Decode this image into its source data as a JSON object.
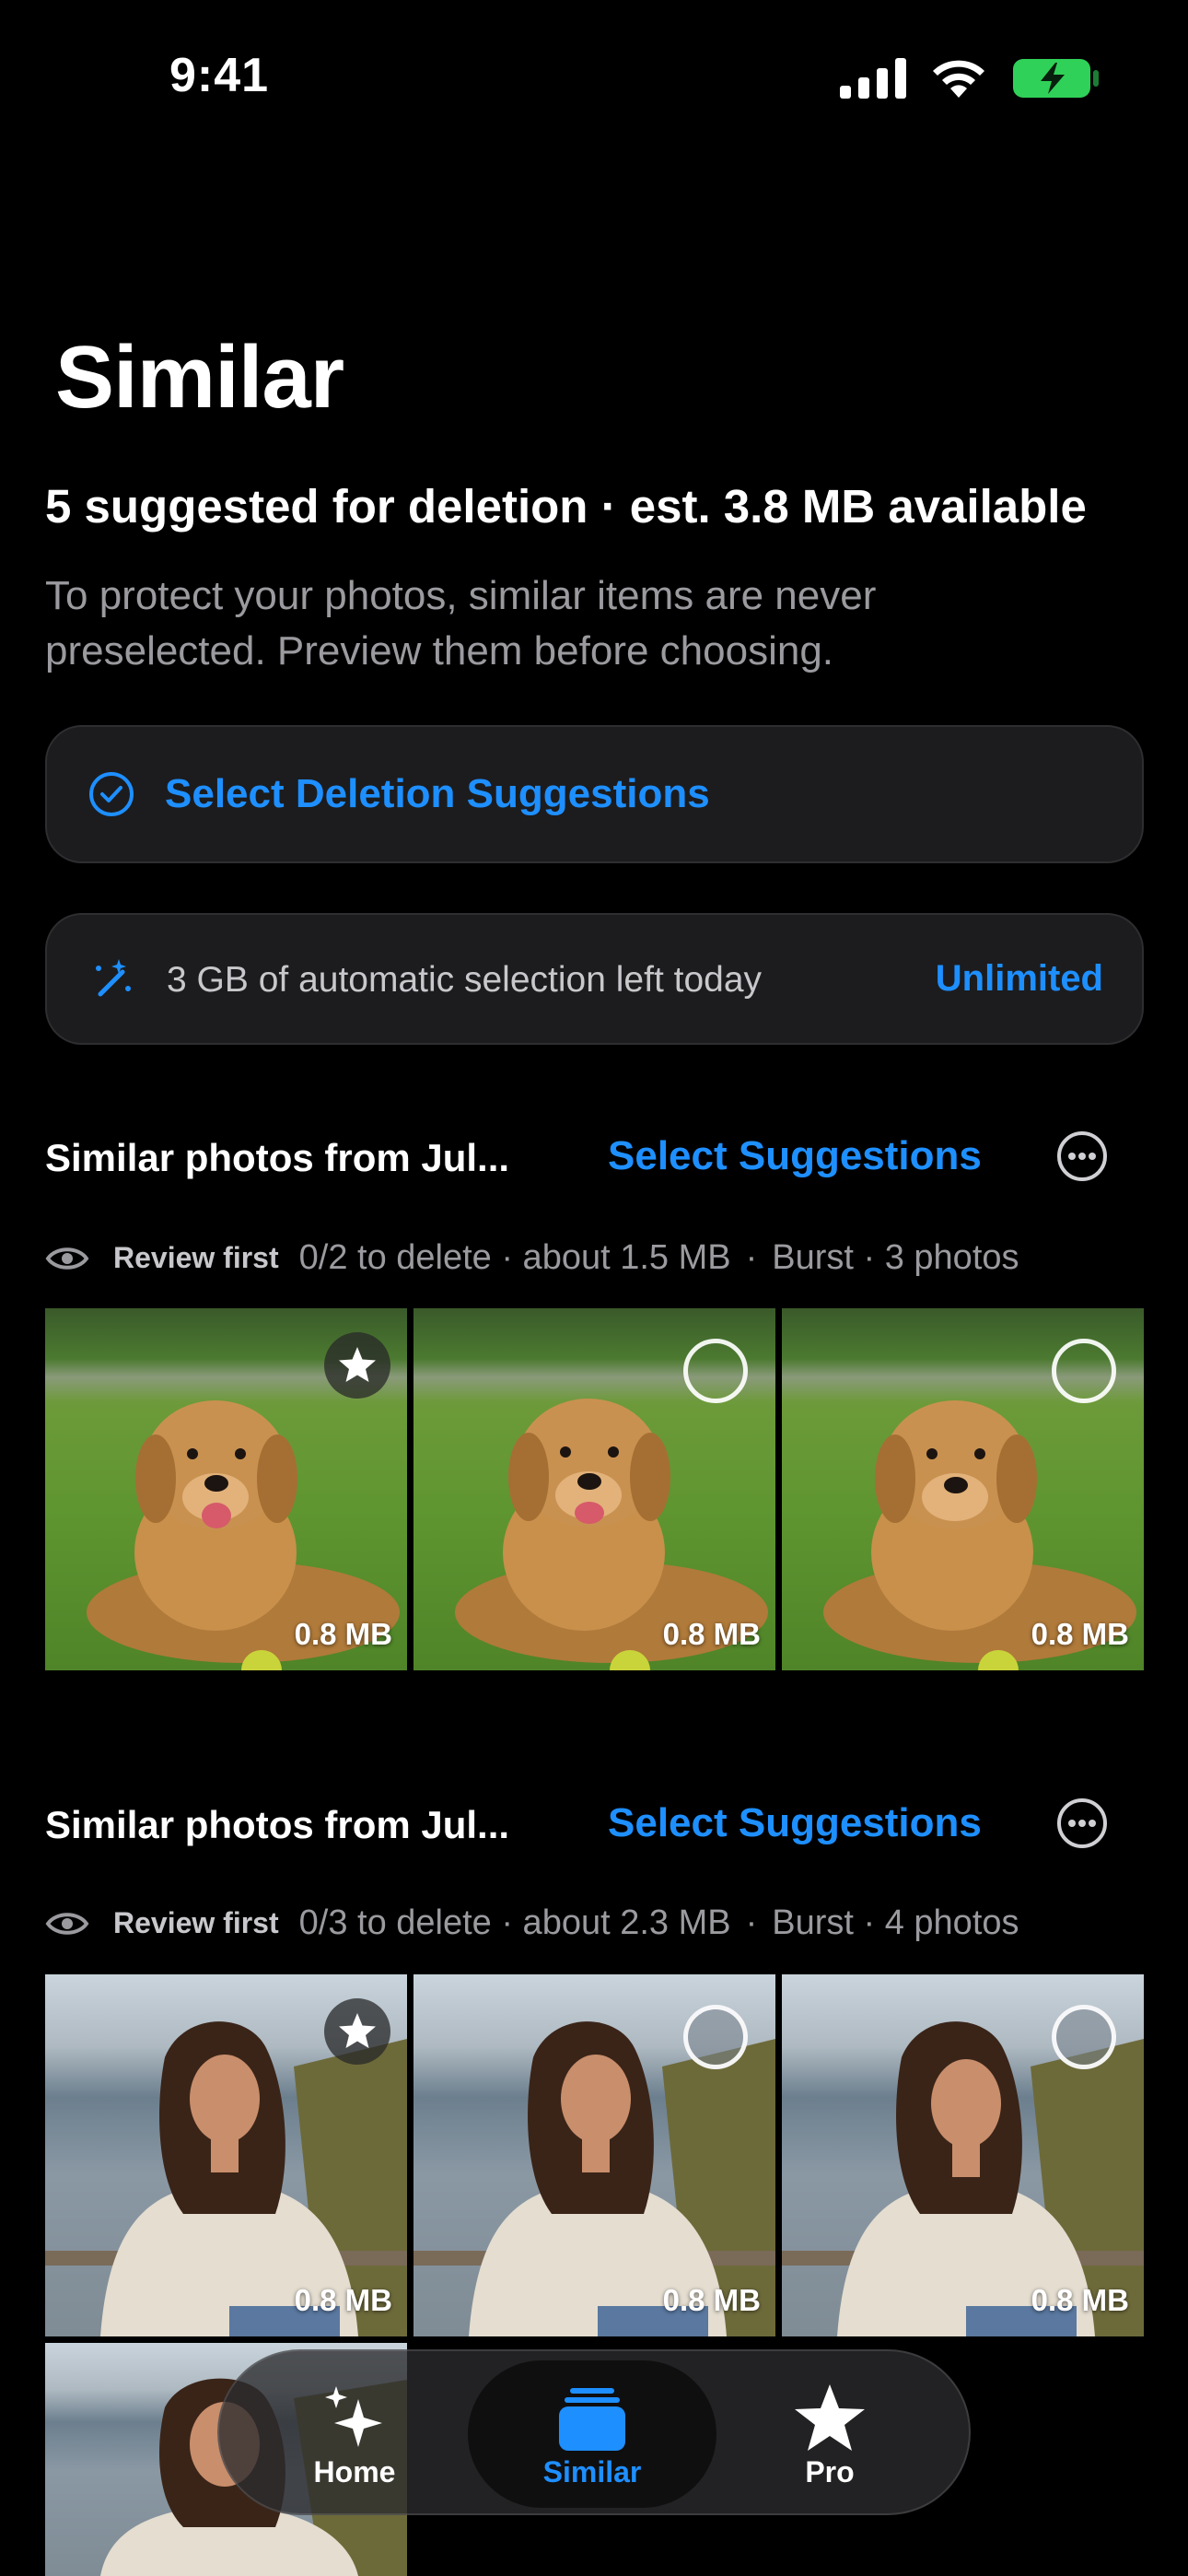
{
  "status": {
    "time": "9:41"
  },
  "page": {
    "title": "Similar",
    "summary": "5 suggested for deletion · est. 3.8 MB available",
    "note": "To protect your photos, similar items are never preselected. Preview them before choosing."
  },
  "actions": {
    "select_suggestions_label": "Select Deletion Suggestions",
    "quota_text": "3 GB of automatic selection left today",
    "upgrade_label": "Unlimited"
  },
  "groups": [
    {
      "title": "Similar photos from Jul...",
      "select_label": "Select Suggestions",
      "review_label": "Review first",
      "delete_count": "0/2 to delete · about 1.5 MB",
      "burst": "Burst · 3 photos",
      "photos": [
        {
          "size": "0.8 MB",
          "state": "best"
        },
        {
          "size": "0.8 MB",
          "state": "unselected"
        },
        {
          "size": "0.8 MB",
          "state": "unselected"
        }
      ]
    },
    {
      "title": "Similar photos from Jul...",
      "select_label": "Select Suggestions",
      "review_label": "Review first",
      "delete_count": "0/3 to delete · about 2.3 MB",
      "burst": "Burst · 4 photos",
      "photos": [
        {
          "size": "0.8 MB",
          "state": "best"
        },
        {
          "size": "0.8 MB",
          "state": "unselected"
        },
        {
          "size": "0.8 MB",
          "state": "unselected"
        },
        {
          "size": "",
          "state": "partial"
        }
      ]
    }
  ],
  "tabbar": {
    "items": [
      {
        "label": "Home",
        "icon": "sparkles-icon"
      },
      {
        "label": "Similar",
        "icon": "stack-icon",
        "active": true
      },
      {
        "label": "Pro",
        "icon": "star-icon"
      }
    ]
  },
  "colors": {
    "accent": "#1e8fff",
    "background": "#000000",
    "card": "#1c1c1e"
  }
}
